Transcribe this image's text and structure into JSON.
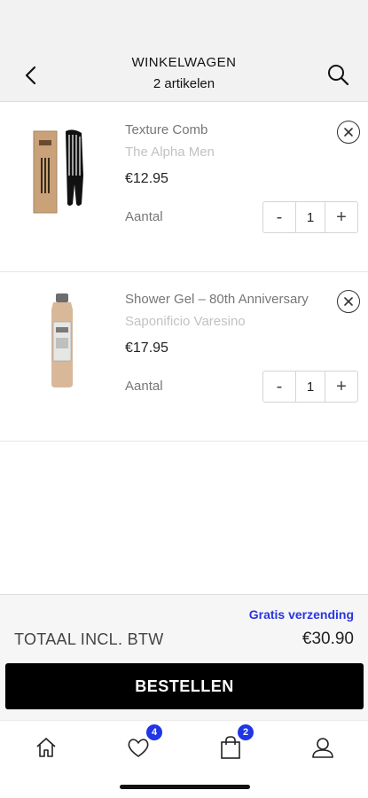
{
  "header": {
    "title": "WINKELWAGEN",
    "subtitle": "2 artikelen",
    "back_icon": "chevron-left-icon",
    "search_icon": "search-icon"
  },
  "cart": {
    "items": [
      {
        "name": "Texture Comb",
        "brand": "The Alpha Men",
        "price": "€12.95",
        "quantity_label": "Aantal",
        "quantity": "1",
        "decrement": "-",
        "increment": "+"
      },
      {
        "name": "Shower Gel – 80th Anniversary",
        "brand": "Saponificio Varesino",
        "price": "€17.95",
        "quantity_label": "Aantal",
        "quantity": "1",
        "decrement": "-",
        "increment": "+"
      }
    ]
  },
  "summary": {
    "shipping": "Gratis verzending",
    "total_label": "TOTAAL INCL. BTW",
    "total_value": "€30.90"
  },
  "order_button": "BESTELLEN",
  "tabbar": {
    "wishlist_badge": "4",
    "cart_badge": "2",
    "icons": [
      "home-icon",
      "heart-icon",
      "shopping-bag-icon",
      "user-icon"
    ]
  },
  "colors": {
    "accent": "#2a35e0",
    "badge": "#1f35e6",
    "button": "#000000"
  }
}
